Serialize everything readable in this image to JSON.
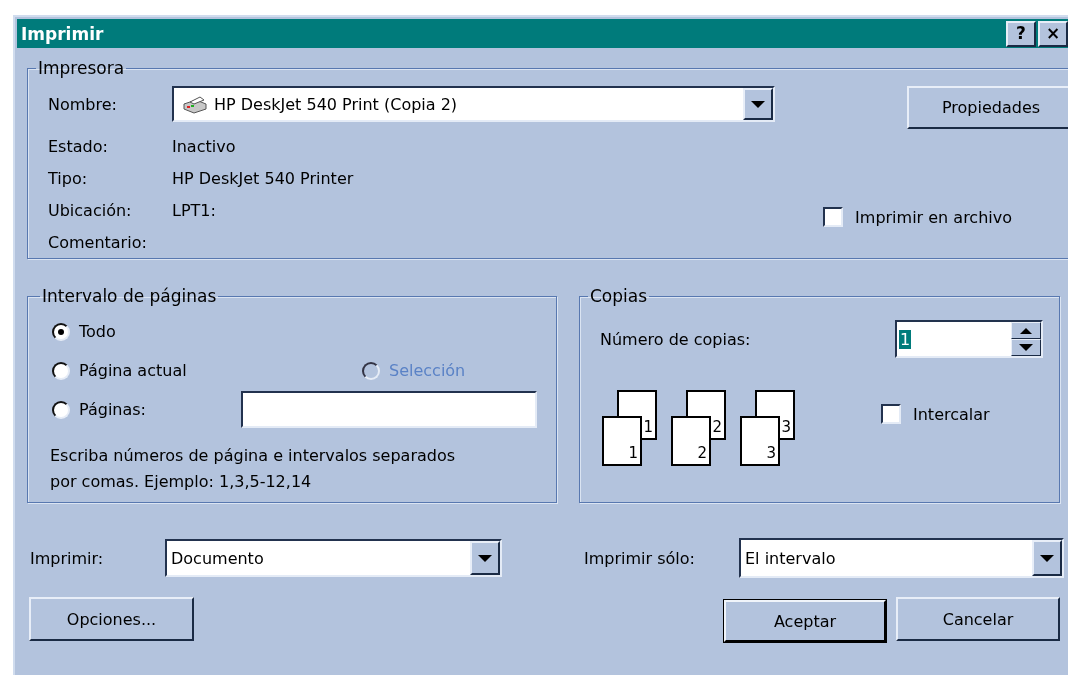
{
  "window": {
    "title": "Imprimir",
    "help_button": "?",
    "close_button": "×"
  },
  "printer": {
    "title": "Impresora",
    "name_label": "Nombre:",
    "name_value": "HP DeskJet 540 Print (Copia 2)",
    "properties_button": "Propiedades",
    "info": [
      {
        "label": "Estado:",
        "value": "Inactivo"
      },
      {
        "label": "Tipo:",
        "value": "HP DeskJet 540 Printer"
      },
      {
        "label": "Ubicación:",
        "value": "LPT1:"
      },
      {
        "label": "Comentario:"
      }
    ],
    "print_to_file": {
      "label": "Imprimir en archivo",
      "checked": false
    }
  },
  "page_range": {
    "title": "Intervalo de páginas",
    "rows": [
      {
        "options": [
          {
            "label": "Todo",
            "selected": true,
            "disabled": false
          }
        ]
      },
      {
        "options": [
          {
            "label": "Página actual",
            "selected": false,
            "disabled": false
          },
          {
            "label": "Selección",
            "selected": false,
            "disabled": true
          }
        ]
      },
      {
        "options": [
          {
            "label": "Páginas:",
            "selected": false,
            "disabled": false,
            "kind": "radio_with_field"
          }
        ]
      }
    ],
    "hint": "Escriba números de página e intervalos separados por comas. Ejemplo: 1,3,5-12,14"
  },
  "copies": {
    "title": "Copias",
    "count_label": "Número de copias:",
    "count_value": "1",
    "count_highlighted": true,
    "stacks": [
      {
        "back": "1",
        "front": "1"
      },
      {
        "back": "2",
        "front": "2"
      },
      {
        "back": "3",
        "front": "3"
      }
    ],
    "collate": {
      "label": "Intercalar",
      "checked": false
    }
  },
  "print_what": {
    "label": "Imprimir:",
    "value": "Documento"
  },
  "print_only": {
    "label": "Imprimir sólo:",
    "value": "El intervalo"
  },
  "buttons": [
    {
      "label": "Opciones...",
      "default": false
    },
    {
      "label": "Aceptar",
      "default": true
    },
    {
      "label": "Cancelar",
      "default": false
    }
  ]
}
